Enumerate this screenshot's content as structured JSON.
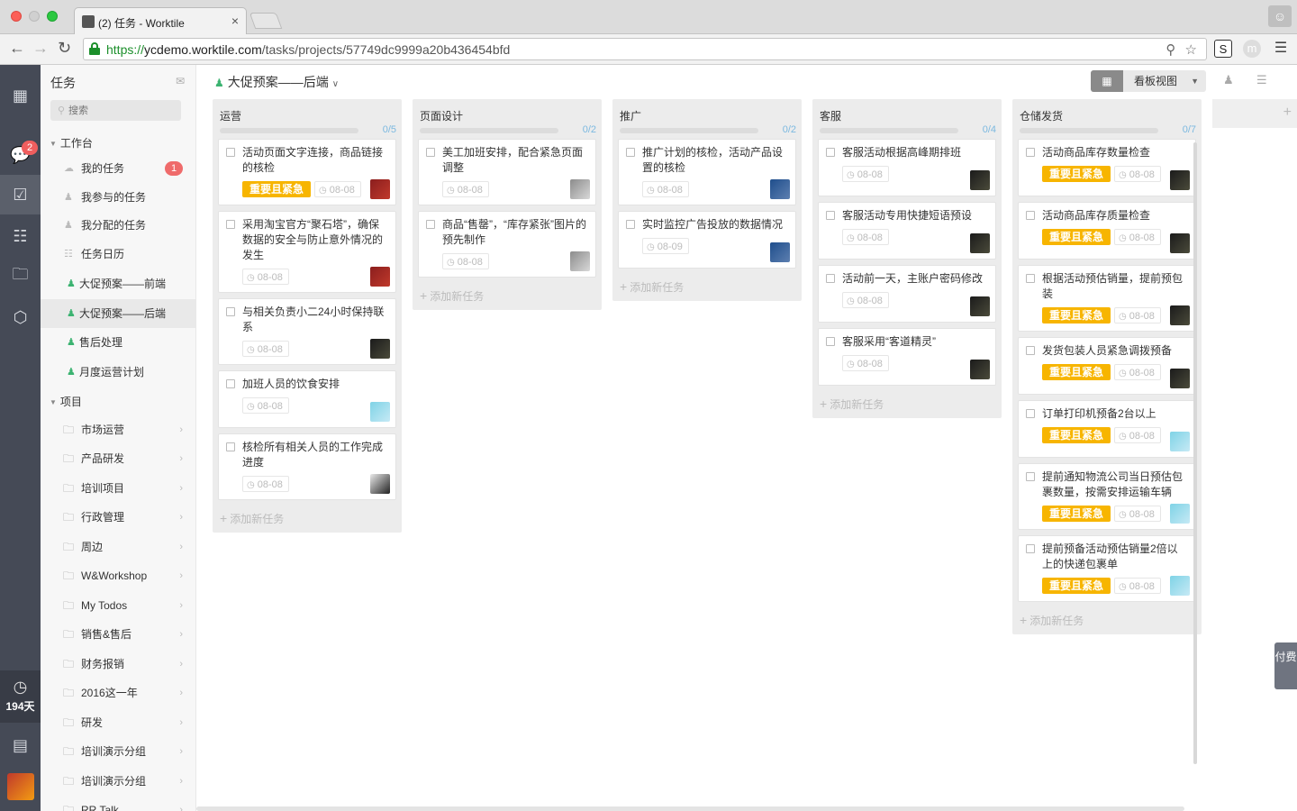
{
  "browser": {
    "tab_title": "(2) 任务 - Worktile",
    "tab_close": "×",
    "url_scheme": "https://",
    "url_host": "ycdemo.worktile.com",
    "url_path": "/tasks/projects/57749dc9999a20b436454bfd"
  },
  "rail": {
    "chat_badge": "2",
    "days_label": "194天"
  },
  "sidebar": {
    "title": "任务",
    "search_placeholder": "搜索",
    "workbench_label": "工作台",
    "workbench_items": [
      {
        "label": "我的任务",
        "count": "1"
      },
      {
        "label": "我参与的任务"
      },
      {
        "label": "我分配的任务"
      },
      {
        "label": "任务日历"
      }
    ],
    "starred_projects": [
      {
        "label": "大促预案——前端"
      },
      {
        "label": "大促预案——后端",
        "active": true
      },
      {
        "label": "售后处理"
      },
      {
        "label": "月度运营计划"
      }
    ],
    "projects_label": "项目",
    "project_folders": [
      "市场运营",
      "产品研发",
      "培训项目",
      "行政管理",
      "周边",
      "W&Workshop",
      "My Todos",
      "销售&售后",
      "财务报销",
      "2016这一年",
      "研发",
      "培训演示分组",
      "培训演示分组",
      "RR Talk"
    ]
  },
  "header": {
    "project_title": "大促预案——后端",
    "view_label": "看板视图"
  },
  "colors": {
    "tag": "#f7b500",
    "rail": "#454a56",
    "accent_green": "#3cb371",
    "count_blue": "#7cb9e0"
  },
  "board": {
    "add_task_label": "添加新任务",
    "columns": [
      {
        "name": "运营",
        "count": "0/5",
        "cards": [
          {
            "title": "活动页面文字连接，商品链接的核检",
            "tag": "重要且紧急",
            "date": "08-08",
            "avatar": "red"
          },
          {
            "title": "采用淘宝官方“聚石塔”，确保数据的安全与防止意外情况的发生",
            "date": "08-08",
            "avatar": "red"
          },
          {
            "title": "与相关负责小二24小时保持联系",
            "date": "08-08",
            "avatar": "dark"
          },
          {
            "title": "加班人员的饮食安排",
            "date": "08-08",
            "avatar": "cyan"
          },
          {
            "title": "核检所有相关人员的工作完成进度",
            "date": "08-08",
            "avatar": "bw"
          }
        ]
      },
      {
        "name": "页面设计",
        "count": "0/2",
        "cards": [
          {
            "title": "美工加班安排，配合紧急页面调整",
            "date": "08-08",
            "avatar": "gray"
          },
          {
            "title": "商品“售罄”，“库存紧张”图片的预先制作",
            "date": "08-08",
            "avatar": "gray"
          }
        ]
      },
      {
        "name": "推广",
        "count": "0/2",
        "cards": [
          {
            "title": "推广计划的核检，活动产品设置的核检",
            "date": "08-08",
            "avatar": "blue"
          },
          {
            "title": "实时监控广告投放的数据情况",
            "date": "08-09",
            "avatar": "blue"
          }
        ]
      },
      {
        "name": "客服",
        "count": "0/4",
        "cards": [
          {
            "title": "客服活动根据高峰期排班",
            "date": "08-08",
            "avatar": "dark"
          },
          {
            "title": "客服活动专用快捷短语预设",
            "date": "08-08",
            "avatar": "dark"
          },
          {
            "title": "活动前一天，主账户密码修改",
            "date": "08-08",
            "avatar": "dark"
          },
          {
            "title": "客服采用“客道精灵”",
            "date": "08-08",
            "avatar": "dark"
          }
        ]
      },
      {
        "name": "仓储发货",
        "count": "0/7",
        "cards": [
          {
            "title": "活动商品库存数量检查",
            "tag": "重要且紧急",
            "date": "08-08",
            "avatar": "dark"
          },
          {
            "title": "活动商品库存质量检查",
            "tag": "重要且紧急",
            "date": "08-08",
            "avatar": "dark"
          },
          {
            "title": "根据活动预估销量，提前预包装",
            "tag": "重要且紧急",
            "date": "08-08",
            "avatar": "dark"
          },
          {
            "title": "发货包装人员紧急调拨预备",
            "tag": "重要且紧急",
            "date": "08-08",
            "avatar": "dark"
          },
          {
            "title": "订单打印机预备2台以上",
            "tag": "重要且紧急",
            "date": "08-08",
            "avatar": "cyan"
          },
          {
            "title": "提前通知物流公司当日预估包裹数量，按需安排运输车辆",
            "tag": "重要且紧急",
            "date": "08-08",
            "avatar": "cyan"
          },
          {
            "title": "提前预备活动预估销量2倍以上的快递包裹单",
            "tag": "重要且紧急",
            "date": "08-08",
            "avatar": "cyan"
          }
        ]
      }
    ]
  },
  "pay_label": "付费"
}
